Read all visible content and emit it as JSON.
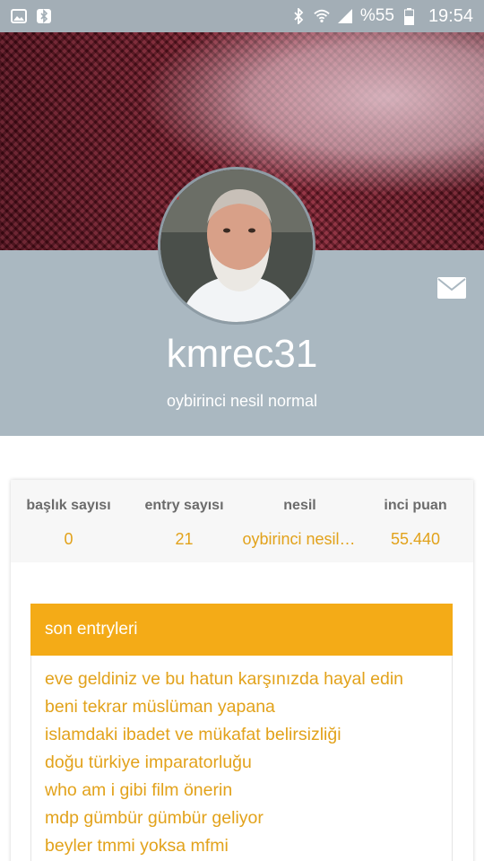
{
  "status_bar": {
    "left_icons": [
      "image-icon",
      "bluetooth-app-icon"
    ],
    "right_icons": [
      "bluetooth-icon",
      "wifi-icon",
      "signal-icon"
    ],
    "battery_text": "%55",
    "time": "19:54"
  },
  "profile": {
    "username": "kmrec31",
    "subtitle": "oybirinci nesil normal",
    "mail_icon": "envelope-icon"
  },
  "stats": [
    {
      "label": "başlık sayısı",
      "value": "0"
    },
    {
      "label": "entry sayısı",
      "value": "21"
    },
    {
      "label": "nesil",
      "value": "oybirinci nesil normal"
    },
    {
      "label": "inci puan",
      "value": "55.440"
    }
  ],
  "recent_entries": {
    "title": "son entryleri",
    "items": [
      "eve geldiniz ve bu hatun karşınızda hayal edin",
      "beni tekrar müslüman yapana",
      "islamdaki ibadet ve mükafat belirsizliği",
      "doğu türkiye imparatorluğu",
      "who am i gibi film önerin",
      "mdp gümbür gümbür geliyor",
      "beyler tmmi yoksa mfmi"
    ]
  },
  "colors": {
    "accent": "#f4ab17",
    "accent_text": "#e2a21b",
    "profile_band": "#aab8c1"
  }
}
